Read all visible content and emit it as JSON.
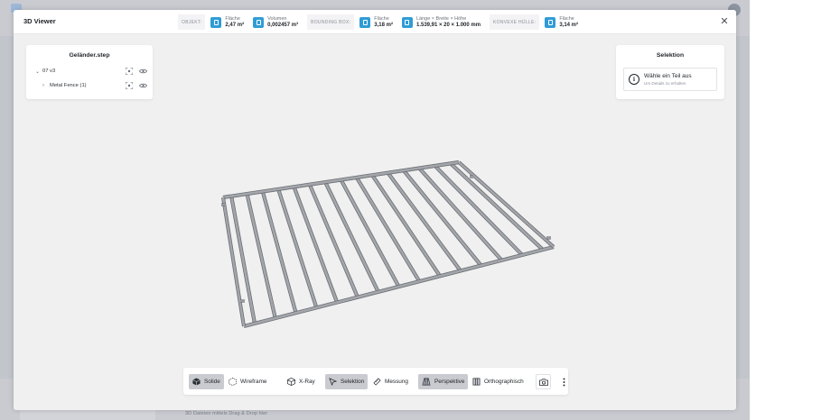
{
  "window": {
    "title": "3D Viewer"
  },
  "header_stats": {
    "objekt_label": "OBJEKT:",
    "objekt_area": {
      "name": "Fläche",
      "value": "2,47 m²"
    },
    "objekt_volume": {
      "name": "Volumen",
      "value": "0,002457 m³"
    },
    "bbox_label": "BOUNDING BOX:",
    "bbox_area": {
      "name": "Fläche",
      "value": "3,18 m²"
    },
    "bbox_dims": {
      "name": "Länge × Breite × Höhe",
      "value": "1.539,91 × 20 × 1.000 mm"
    },
    "hull_label": "KONVEXE HÜLLE:",
    "hull_area": {
      "name": "Fläche",
      "value": "3,14 m²"
    }
  },
  "tree": {
    "title": "Geländer.step",
    "items": [
      {
        "label": "07 v3",
        "chevron": "⌄"
      },
      {
        "label": "Metal Fence (1)",
        "chevron": "›"
      }
    ]
  },
  "selection": {
    "title": "Selektion",
    "main_text": "Wähle ein Teil aus",
    "sub_text": "Um Details zu erhalten"
  },
  "toolbar": {
    "solid_label": "Solide",
    "wireframe_label": "Wireframe",
    "xray_label": "X-Ray",
    "selection_label": "Selektion",
    "measure_label": "Messung",
    "perspective_label": "Perspektive",
    "ortho_label": "Orthographisch"
  },
  "background": {
    "footer_hint": "3D Dateien mittels Drag & Drop hier"
  },
  "colors": {
    "accent": "#2f9cd6",
    "model_stroke": "#6b6e73",
    "model_fill": "#a3a6ab",
    "active_button": "#c9cbd0"
  }
}
